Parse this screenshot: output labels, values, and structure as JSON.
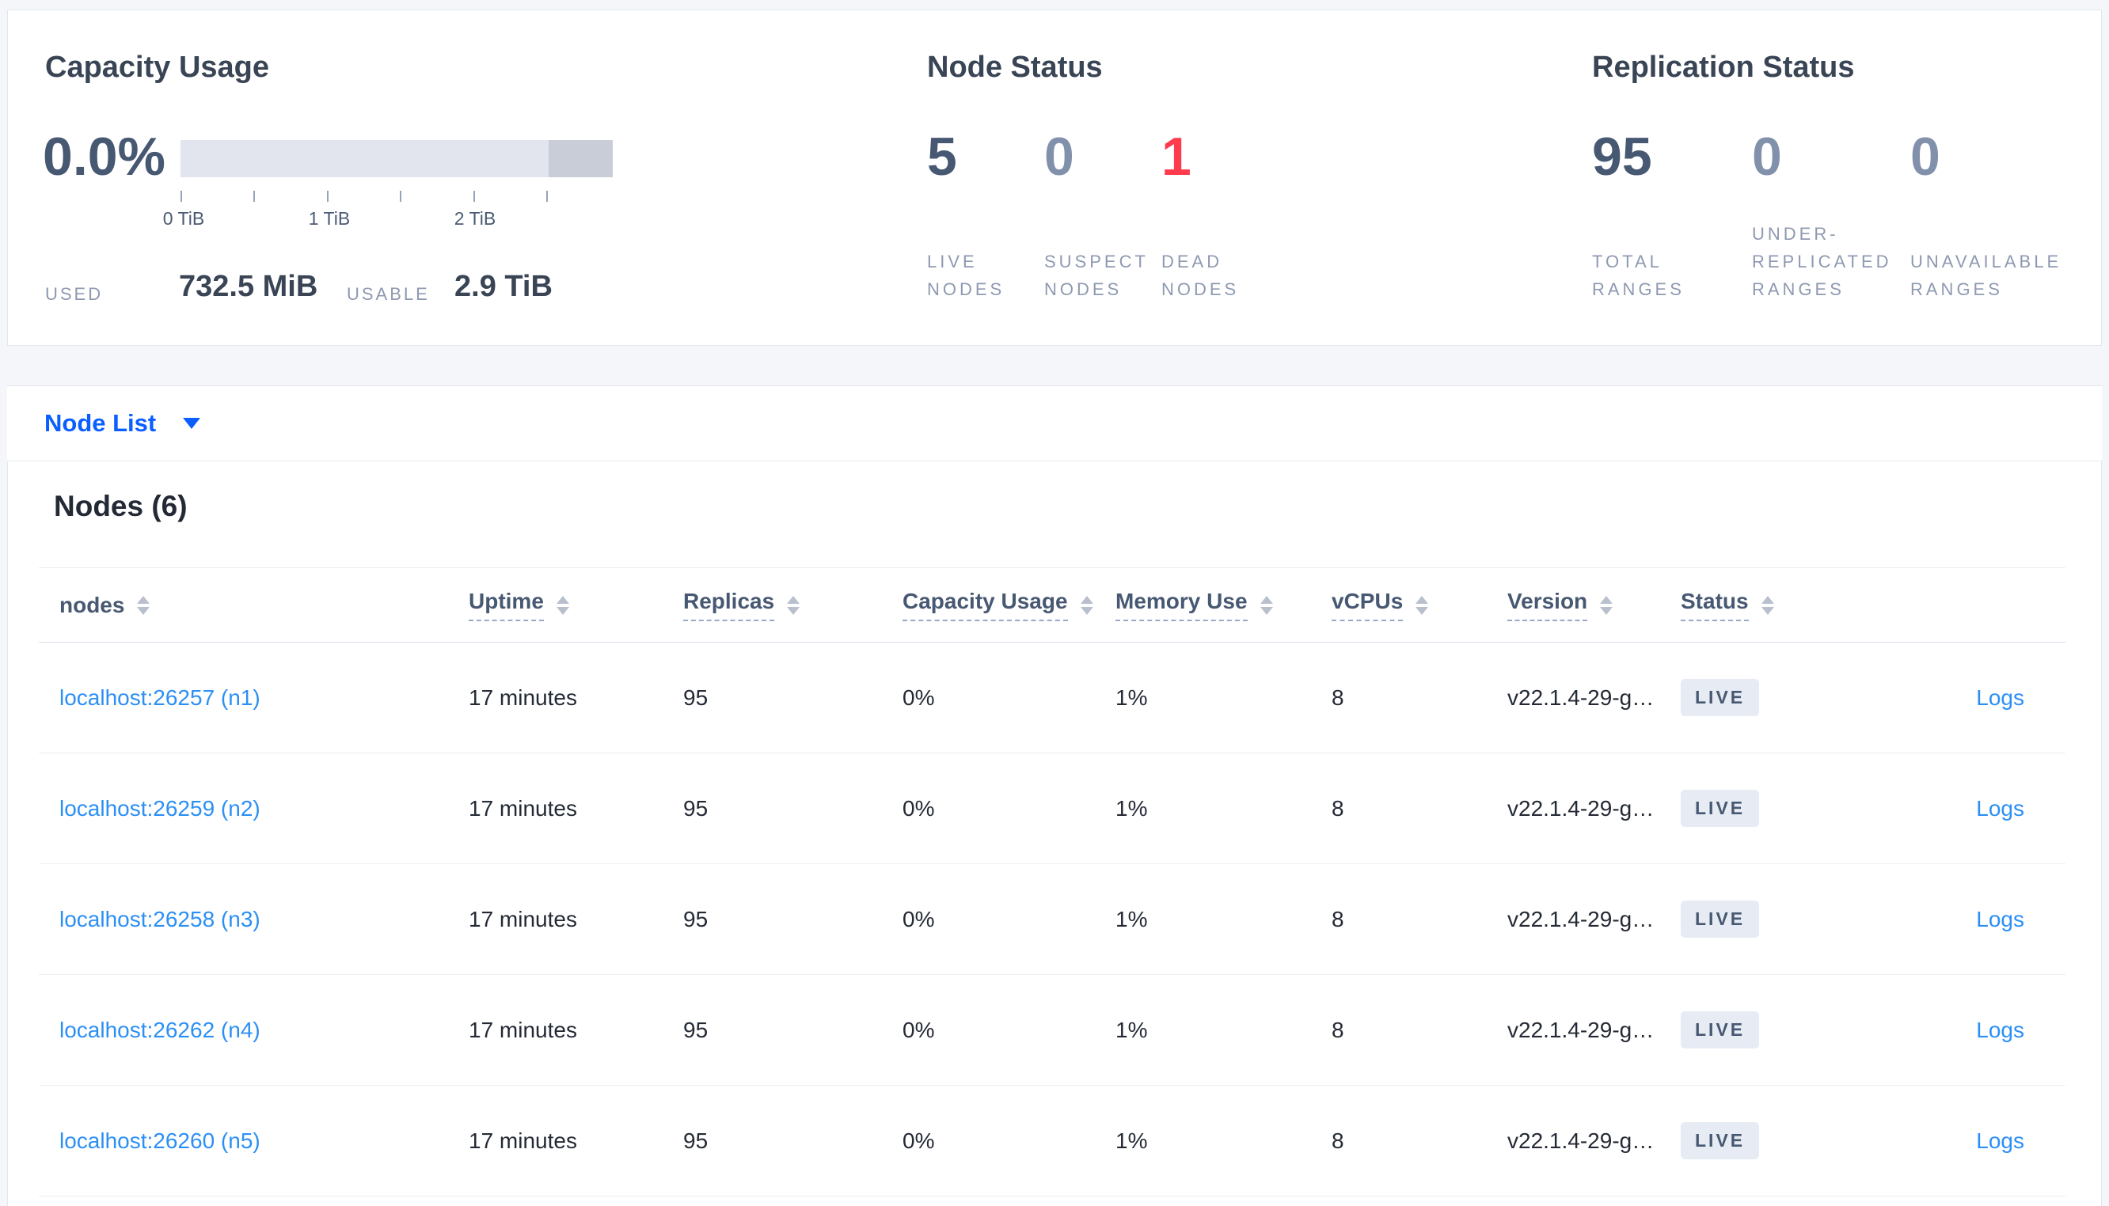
{
  "overview": {
    "capacity": {
      "title": "Capacity Usage",
      "percent": "0.0%",
      "ticks": [
        "0 TiB",
        "1 TiB",
        "2 TiB"
      ],
      "used_label": "USED",
      "used_value": "732.5 MiB",
      "usable_label": "USABLE",
      "usable_value": "2.9 TiB"
    },
    "node_status": {
      "title": "Node Status",
      "stats": [
        {
          "value": "5",
          "label": "LIVE\nNODES"
        },
        {
          "value": "0",
          "label": "SUSPECT\nNODES"
        },
        {
          "value": "1",
          "label": "DEAD\nNODES"
        }
      ]
    },
    "replication": {
      "title": "Replication Status",
      "stats": [
        {
          "value": "95",
          "label": "TOTAL\nRANGES"
        },
        {
          "value": "0",
          "label": "UNDER-\nREPLICATED\nRANGES"
        },
        {
          "value": "0",
          "label": "UNAVAILABLE\nRANGES"
        }
      ]
    }
  },
  "view_selector": {
    "label": "Node List",
    "icon": "caret-down-icon"
  },
  "nodes": {
    "heading": "Nodes (6)",
    "columns": [
      {
        "label": "nodes"
      },
      {
        "label": "Uptime"
      },
      {
        "label": "Replicas"
      },
      {
        "label": "Capacity Usage"
      },
      {
        "label": "Memory Use"
      },
      {
        "label": "vCPUs"
      },
      {
        "label": "Version"
      },
      {
        "label": "Status"
      }
    ],
    "rows": [
      {
        "address": "localhost:26257 (n1)",
        "uptime": "17 minutes",
        "replicas": "95",
        "capacity": "0%",
        "memory": "1%",
        "vcpus": "8",
        "version": "v22.1.4-29-g…",
        "status": "LIVE",
        "logs": "Logs"
      },
      {
        "address": "localhost:26259 (n2)",
        "uptime": "17 minutes",
        "replicas": "95",
        "capacity": "0%",
        "memory": "1%",
        "vcpus": "8",
        "version": "v22.1.4-29-g…",
        "status": "LIVE",
        "logs": "Logs"
      },
      {
        "address": "localhost:26258 (n3)",
        "uptime": "17 minutes",
        "replicas": "95",
        "capacity": "0%",
        "memory": "1%",
        "vcpus": "8",
        "version": "v22.1.4-29-g…",
        "status": "LIVE",
        "logs": "Logs"
      },
      {
        "address": "localhost:26262 (n4)",
        "uptime": "17 minutes",
        "replicas": "95",
        "capacity": "0%",
        "memory": "1%",
        "vcpus": "8",
        "version": "v22.1.4-29-g…",
        "status": "LIVE",
        "logs": "Logs"
      },
      {
        "address": "localhost:26260 (n5)",
        "uptime": "17 minutes",
        "replicas": "95",
        "capacity": "0%",
        "memory": "1%",
        "vcpus": "8",
        "version": "v22.1.4-29-g…",
        "status": "LIVE",
        "logs": "Logs"
      }
    ]
  },
  "colors": {
    "link_blue": "#2b8ff5",
    "selector_blue": "#0b5fff",
    "dead_red": "#ff3b4e",
    "slate": "#475872",
    "badge_bg": "#e7ecf4",
    "bar_track": "#e3e5ee",
    "bar_dark": "#c9cdd8"
  }
}
